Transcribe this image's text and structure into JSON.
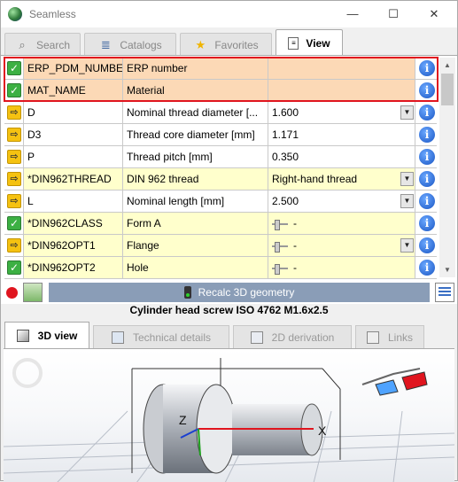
{
  "window": {
    "title": "Seamless",
    "minimize": "—",
    "maximize": "☐",
    "close": "✕"
  },
  "tabs": [
    {
      "label": "Search",
      "icon": "magnifier-icon",
      "glyph": "🔍",
      "active": false
    },
    {
      "label": "Catalogs",
      "icon": "catalog-stack-icon",
      "glyph": "📚",
      "active": false
    },
    {
      "label": "Favorites",
      "icon": "star-icon",
      "glyph": "★",
      "active": false
    },
    {
      "label": "View",
      "icon": "document-icon",
      "glyph": "📄",
      "active": true
    }
  ],
  "properties": [
    {
      "icon": "check",
      "name": "ERP_PDM_NUMBER",
      "description": "ERP number",
      "value": "",
      "style": "orange",
      "control": "none"
    },
    {
      "icon": "check",
      "name": "MAT_NAME",
      "description": "Material",
      "value": "",
      "style": "orange",
      "control": "none"
    },
    {
      "icon": "arrow",
      "name": "D",
      "description": "Nominal thread diameter [...",
      "value": "1.600",
      "style": "white",
      "control": "dropdown"
    },
    {
      "icon": "arrow",
      "name": "D3",
      "description": "Thread core diameter [mm]",
      "value": "1.171",
      "style": "white",
      "control": "none"
    },
    {
      "icon": "arrow",
      "name": "P",
      "description": "Thread pitch [mm]",
      "value": "0.350",
      "style": "white",
      "control": "none"
    },
    {
      "icon": "arrow",
      "name": "*DIN962THREAD",
      "description": "DIN 962 thread",
      "value": "Right-hand thread",
      "style": "yellow",
      "control": "dropdown"
    },
    {
      "icon": "arrow",
      "name": "L",
      "description": "Nominal length [mm]",
      "value": "2.500",
      "style": "white",
      "control": "dropdown"
    },
    {
      "icon": "check",
      "name": "*DIN962CLASS",
      "description": "Form A",
      "value": "-",
      "style": "yellow",
      "control": "slider"
    },
    {
      "icon": "arrow",
      "name": "*DIN962OPT1",
      "description": "Flange",
      "value": "-",
      "style": "yellow",
      "control": "slider-dropdown"
    },
    {
      "icon": "check",
      "name": "*DIN962OPT2",
      "description": "Hole",
      "value": "-",
      "style": "yellow",
      "control": "slider"
    }
  ],
  "actions": {
    "recalc_label": "Recalc 3D geometry"
  },
  "part_title": "Cylinder head screw ISO 4762 M1.6x2.5",
  "bottom_tabs": [
    {
      "label": "3D view",
      "icon": "3d-view-icon",
      "active": true
    },
    {
      "label": "Technical details",
      "icon": "technical-details-icon",
      "active": false
    },
    {
      "label": "2D derivation",
      "icon": "2d-derivation-icon",
      "active": false
    },
    {
      "label": "Links",
      "icon": "links-icon",
      "active": false
    }
  ],
  "viewport": {
    "axis_x": "X",
    "axis_z": "Z",
    "colors": {
      "axis_x": "#e0151f",
      "axis_z": "#1a3fd0",
      "axis_y": "#1ea01e"
    }
  }
}
